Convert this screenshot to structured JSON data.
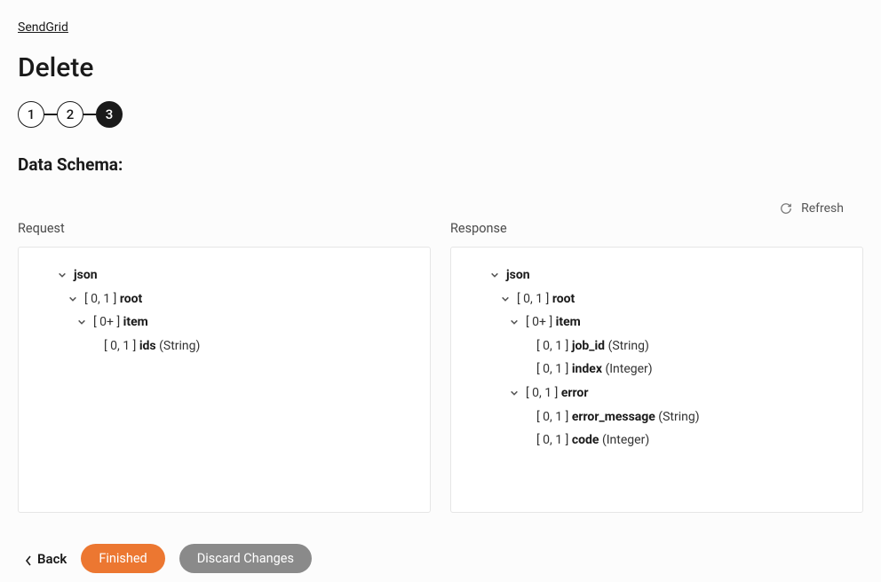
{
  "breadcrumb": "SendGrid",
  "page_title": "Delete",
  "stepper": {
    "steps": [
      "1",
      "2",
      "3"
    ],
    "active_index": 2
  },
  "section_title": "Data Schema:",
  "refresh_label": "Refresh",
  "panels": {
    "request": {
      "header": "Request",
      "rows": [
        {
          "indent": 0,
          "chevron": true,
          "card": "",
          "name": "json",
          "type": ""
        },
        {
          "indent": 1,
          "chevron": true,
          "card": "[ 0, 1 ]",
          "name": "root",
          "type": ""
        },
        {
          "indent": 2,
          "chevron": true,
          "card": "[ 0+ ]",
          "name": "item",
          "type": ""
        },
        {
          "indent": 3,
          "chevron": false,
          "card": "[ 0, 1 ]",
          "name": "ids",
          "type": "(String)"
        }
      ]
    },
    "response": {
      "header": "Response",
      "rows": [
        {
          "indent": 0,
          "chevron": true,
          "card": "",
          "name": "json",
          "type": ""
        },
        {
          "indent": 1,
          "chevron": true,
          "card": "[ 0, 1 ]",
          "name": "root",
          "type": ""
        },
        {
          "indent": 2,
          "chevron": true,
          "card": "[ 0+ ]",
          "name": "item",
          "type": ""
        },
        {
          "indent": 3,
          "chevron": false,
          "card": "[ 0, 1 ]",
          "name": "job_id",
          "type": "(String)"
        },
        {
          "indent": 3,
          "chevron": false,
          "card": "[ 0, 1 ]",
          "name": "index",
          "type": "(Integer)"
        },
        {
          "indent": 2,
          "chevron": true,
          "card": "[ 0, 1 ]",
          "name": "error",
          "type": "",
          "extra_indent": true
        },
        {
          "indent": 4,
          "chevron": false,
          "card": "[ 0, 1 ]",
          "name": "error_message",
          "type": "(String)"
        },
        {
          "indent": 4,
          "chevron": false,
          "card": "[ 0, 1 ]",
          "name": "code",
          "type": "(Integer)"
        }
      ]
    }
  },
  "footer": {
    "back": "Back",
    "finished": "Finished",
    "discard": "Discard Changes"
  }
}
